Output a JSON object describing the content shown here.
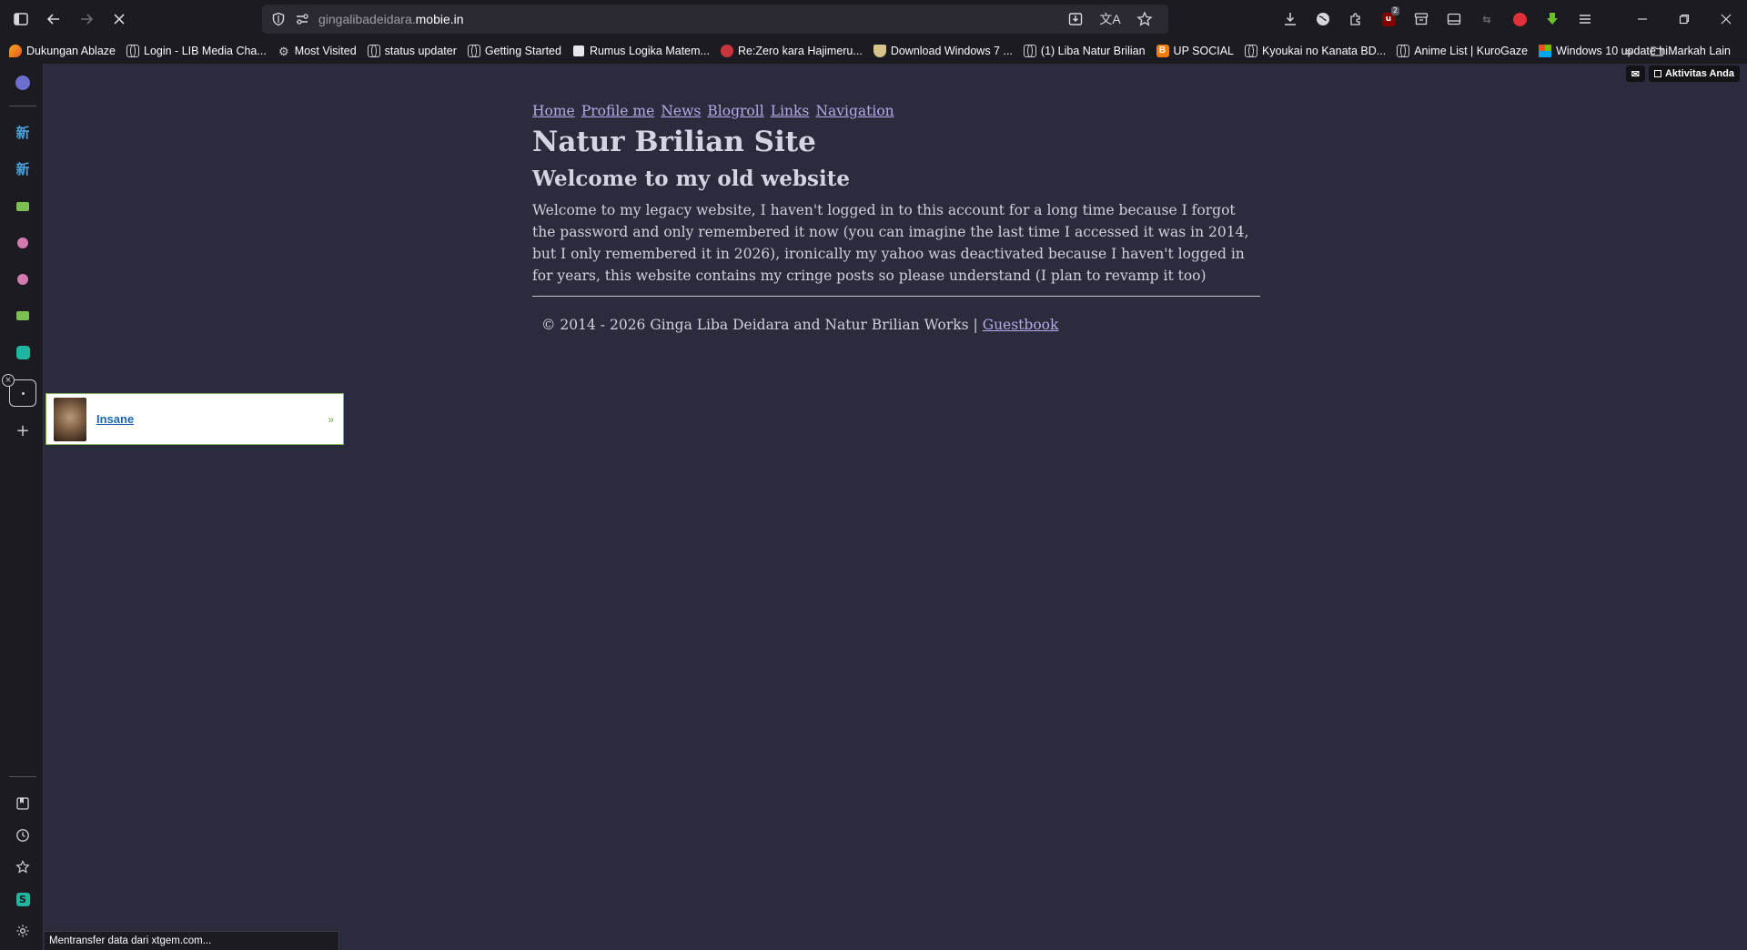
{
  "browser": {
    "url_dim": "gingalibadeidara.",
    "url_host": "mobie.in",
    "status_text": "Mentransfer data dari xtgem.com...",
    "badge_count": "2"
  },
  "bookmarks": [
    {
      "label": "Dukungan Ablaze",
      "icon": "fire-icon"
    },
    {
      "label": "Login - LIB Media Cha...",
      "icon": "globe-icon"
    },
    {
      "label": "Most Visited",
      "icon": "gear-icon"
    },
    {
      "label": "status updater",
      "icon": "globe-icon"
    },
    {
      "label": "Getting Started",
      "icon": "globe-icon"
    },
    {
      "label": "Rumus Logika Matem...",
      "icon": "page-icon"
    },
    {
      "label": "Re:Zero kara Hajimeru...",
      "icon": "anime-icon"
    },
    {
      "label": "Download Windows 7 ...",
      "icon": "shield-icon"
    },
    {
      "label": "(1) Liba Natur Brilian",
      "icon": "globe-icon"
    },
    {
      "label": "UP SOCIAL",
      "icon": "blogger-icon"
    },
    {
      "label": "Kyoukai no Kanata BD...",
      "icon": "globe-icon"
    },
    {
      "label": "Anime List | KuroGaze",
      "icon": "globe-icon"
    },
    {
      "label": "Windows 10 update hi...",
      "icon": "windows-icon"
    }
  ],
  "bookmarks_other": "Markah Lain",
  "sidebar_items": [
    {
      "glyph": "新",
      "name": "sidebar-item-dictionary-1"
    },
    {
      "glyph": "新",
      "name": "sidebar-item-dictionary-2"
    }
  ],
  "page": {
    "nav": [
      "Home",
      "Profile me",
      "News",
      "Blogroll",
      "Links",
      "Navigation"
    ],
    "title": "Natur Brilian Site",
    "subtitle": "Welcome to my old website",
    "body": "Welcome to my legacy website, I haven't logged in to this account for a long time because I forgot the password and only remembered it now (you can imagine the last time I accessed it was in 2014, but I only remembered it in 2026), ironically my yahoo was deactivated because I haven't logged in for years, this website contains my cringe posts so please understand (I plan to revamp it too)",
    "footer_text": "© 2014 - 2026 Ginga Liba Deidara and Natur Brilian Works | ",
    "footer_link": "Guestbook",
    "activity_label": "Aktivitas Anda"
  },
  "ad": {
    "link": "Insane",
    "arrow": "»"
  },
  "colors": {
    "page_bg": "#2a2b3d",
    "chrome_bg": "#1c1b22",
    "link": "#b7a9e8",
    "text": "#d0d1de"
  }
}
